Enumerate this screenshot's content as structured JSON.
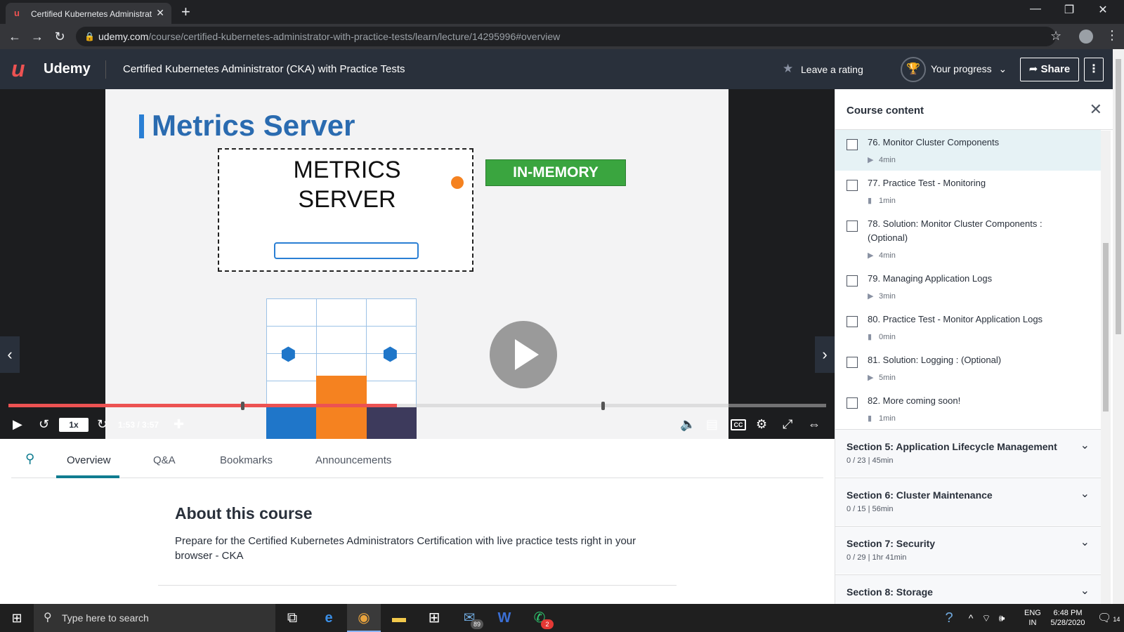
{
  "browser": {
    "tab_title": "Certified Kubernetes Administrat",
    "tab_favicon": "u",
    "url_host": "udemy.com",
    "url_path": "/course/certified-kubernetes-administrator-with-practice-tests/learn/lecture/14295996#overview"
  },
  "header": {
    "logo_text": "Udemy",
    "course_title": "Certified Kubernetes Administrator (CKA) with Practice Tests",
    "rating_label": "Leave a rating",
    "progress_label": "Your progress",
    "share_label": "Share"
  },
  "slide": {
    "title": "Metrics Server",
    "box_text": "METRICS\nSERVER",
    "badge": "IN-MEMORY"
  },
  "player": {
    "speed": "1x",
    "time": "1:53 / 3:57",
    "played_fraction": 0.475,
    "cc_label": "CC"
  },
  "tabs": [
    "Overview",
    "Q&A",
    "Bookmarks",
    "Announcements"
  ],
  "about": {
    "title": "About this course",
    "text": "Prepare for the Certified Kubernetes Administrators Certification with live practice tests right in your browser - CKA"
  },
  "sidebar": {
    "title": "Course content",
    "lectures": [
      {
        "title": "76. Monitor Cluster Components",
        "duration": "4min",
        "type": "video",
        "active": true
      },
      {
        "title": "77. Practice Test - Monitoring",
        "duration": "1min",
        "type": "file"
      },
      {
        "title": "78. Solution: Monitor Cluster Components : (Optional)",
        "duration": "4min",
        "type": "video"
      },
      {
        "title": "79. Managing Application Logs",
        "duration": "3min",
        "type": "video"
      },
      {
        "title": "80. Practice Test - Monitor Application Logs",
        "duration": "0min",
        "type": "file"
      },
      {
        "title": "81. Solution: Logging : (Optional)",
        "duration": "5min",
        "type": "video"
      },
      {
        "title": "82. More coming soon!",
        "duration": "1min",
        "type": "file"
      }
    ],
    "sections": [
      {
        "title": "Section 5: Application Lifecycle Management",
        "meta": "0 / 23 | 45min"
      },
      {
        "title": "Section 6: Cluster Maintenance",
        "meta": "0 / 15 | 56min"
      },
      {
        "title": "Section 7: Security",
        "meta": "0 / 29 | 1hr 41min"
      },
      {
        "title": "Section 8: Storage",
        "meta": ""
      }
    ]
  },
  "taskbar": {
    "search_placeholder": "Type here to search",
    "mail_badge": "89",
    "whatsapp_badge": "2",
    "lang_top": "ENG",
    "lang_bottom": "IN",
    "time": "6:48 PM",
    "date": "5/28/2020",
    "notif_count": "14"
  }
}
